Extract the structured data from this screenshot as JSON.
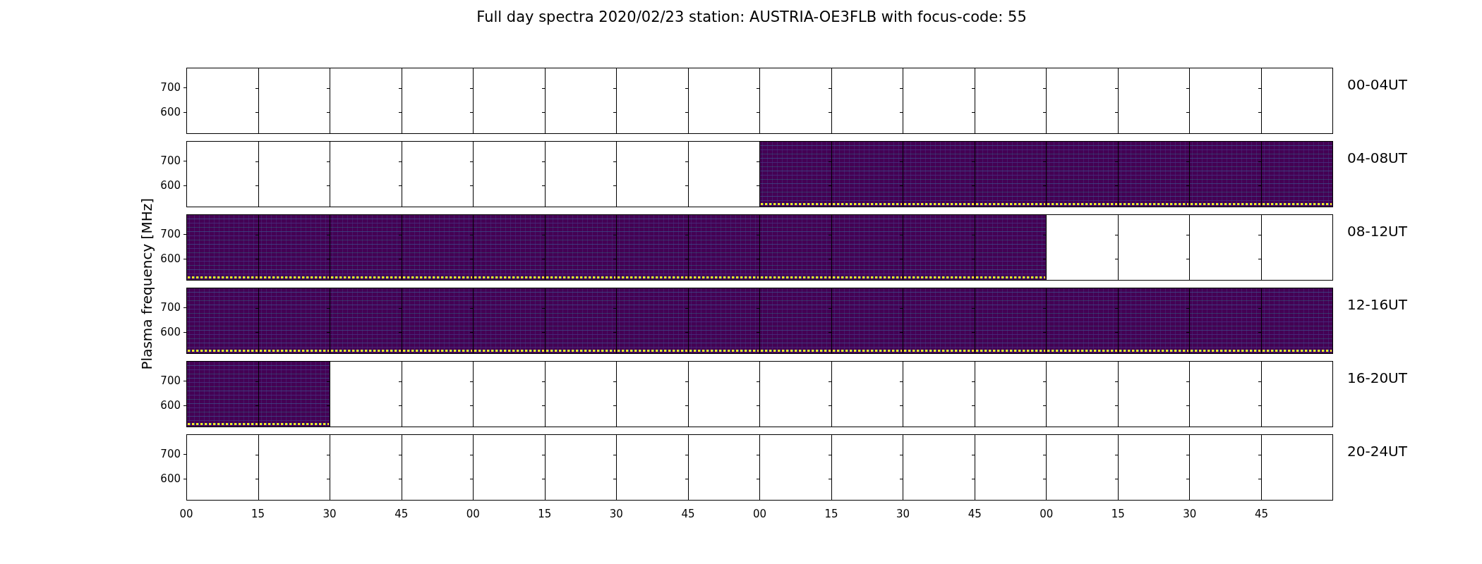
{
  "title": "Full day spectra 2020/02/23 station: AUSTRIA-OE3FLB with focus-code: 55",
  "ylabel": "Plasma frequency [MHz]",
  "rows": [
    {
      "label": "00-04UT",
      "yticks": [
        "700",
        "600"
      ],
      "cells": [
        false,
        false,
        false,
        false,
        false,
        false,
        false,
        false,
        false,
        false,
        false,
        false,
        false,
        false,
        false,
        false
      ]
    },
    {
      "label": "04-08UT",
      "yticks": [
        "700",
        "600"
      ],
      "cells": [
        false,
        false,
        false,
        false,
        false,
        false,
        false,
        false,
        true,
        true,
        true,
        true,
        true,
        true,
        true,
        true
      ]
    },
    {
      "label": "08-12UT",
      "yticks": [
        "700",
        "600"
      ],
      "cells": [
        true,
        true,
        true,
        true,
        true,
        true,
        true,
        true,
        true,
        true,
        true,
        true,
        false,
        false,
        false,
        false
      ]
    },
    {
      "label": "12-16UT",
      "yticks": [
        "700",
        "600"
      ],
      "cells": [
        true,
        true,
        true,
        true,
        true,
        true,
        true,
        true,
        true,
        true,
        true,
        true,
        true,
        true,
        true,
        true
      ]
    },
    {
      "label": "16-20UT",
      "yticks": [
        "700",
        "600"
      ],
      "cells": [
        true,
        true,
        false,
        false,
        false,
        false,
        false,
        false,
        false,
        false,
        false,
        false,
        false,
        false,
        false,
        false
      ]
    },
    {
      "label": "20-24UT",
      "yticks": [
        "700",
        "600"
      ],
      "cells": [
        false,
        false,
        false,
        false,
        false,
        false,
        false,
        false,
        false,
        false,
        false,
        false,
        false,
        false,
        false,
        false
      ]
    }
  ],
  "xticks": [
    "00",
    "15",
    "30",
    "45",
    "00",
    "15",
    "30",
    "45",
    "00",
    "15",
    "30",
    "45",
    "00",
    "15",
    "30",
    "45"
  ]
}
